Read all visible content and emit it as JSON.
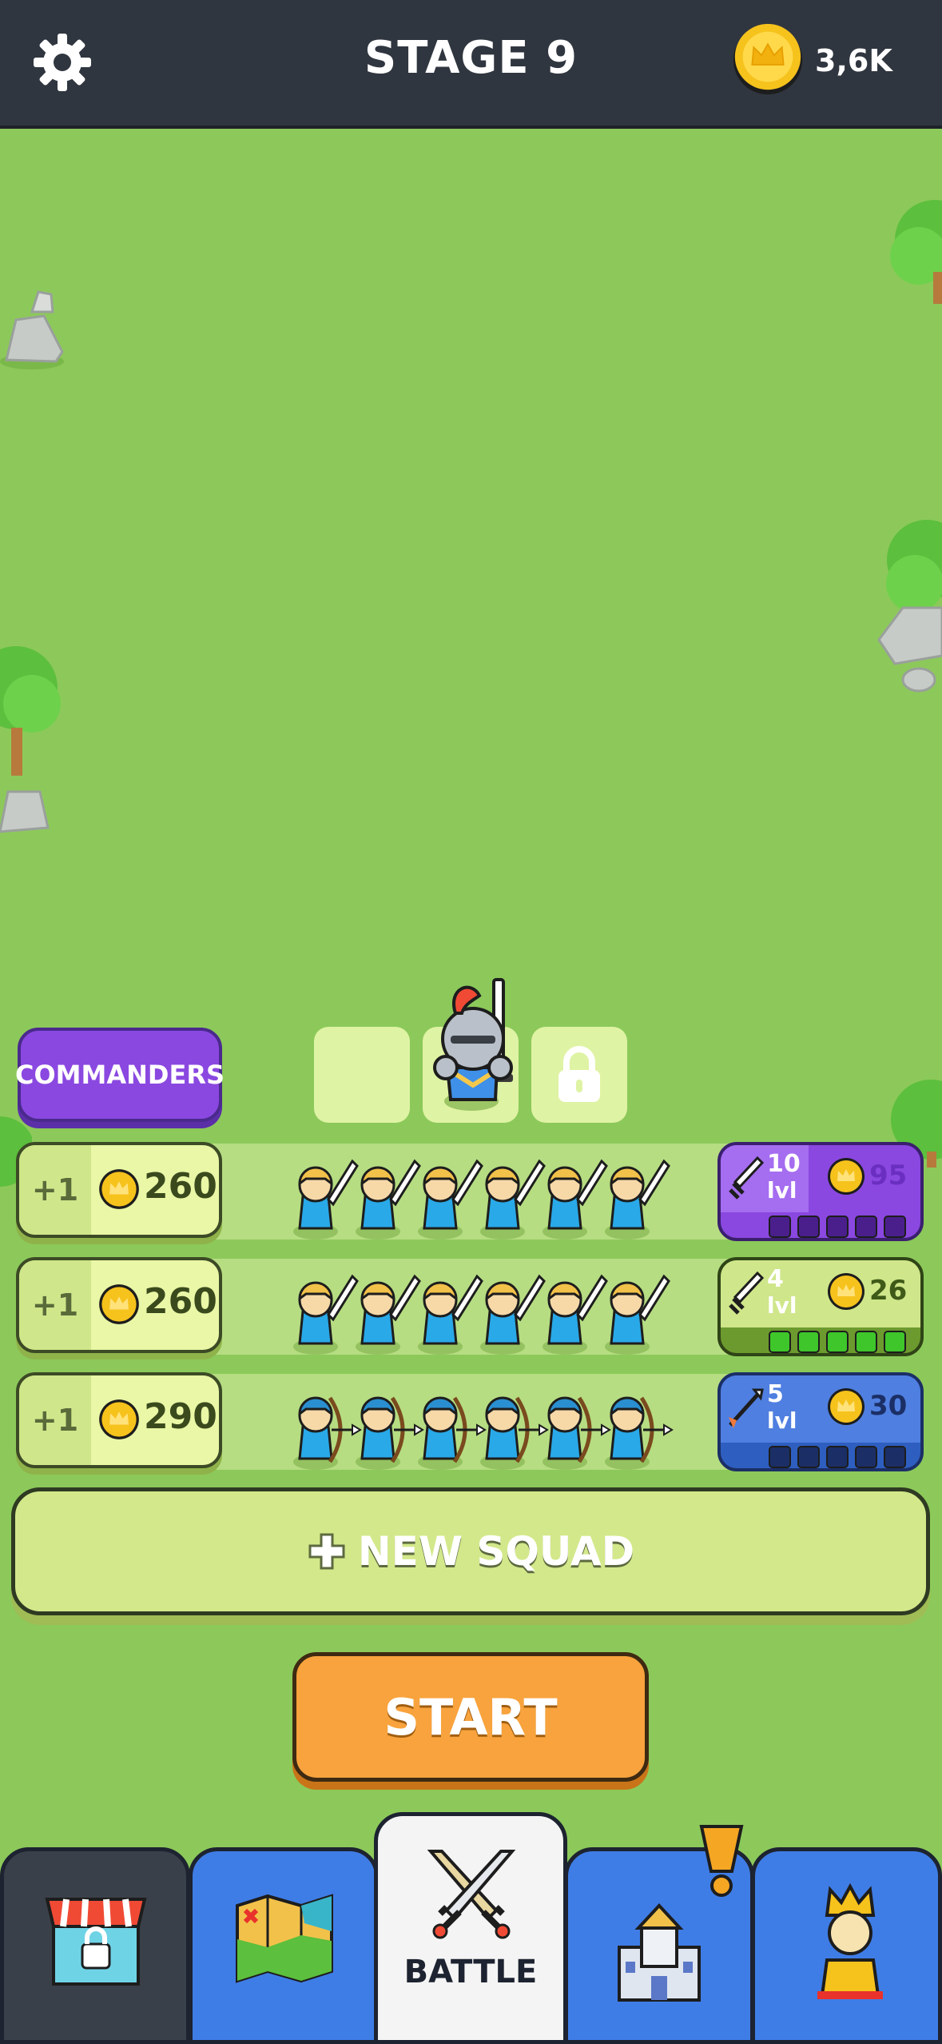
{
  "header": {
    "stage_title": "STAGE 9",
    "coins": "3,6K",
    "settings_icon": "gear-icon",
    "coin_icon": "crown-coin-icon"
  },
  "commanders": {
    "label": "COMMANDERS",
    "slots": [
      "empty",
      "knight-commander",
      "locked"
    ]
  },
  "squads": [
    {
      "buy_plus": "+1",
      "price": "260",
      "unit": "swordsman",
      "count": 6,
      "upgrade": {
        "level": "10",
        "lvl_label": "lvl",
        "cost": "95",
        "theme": "purple",
        "filled": 0,
        "total": 5
      }
    },
    {
      "buy_plus": "+1",
      "price": "260",
      "unit": "swordsman",
      "count": 6,
      "upgrade": {
        "level": "4",
        "lvl_label": "lvl",
        "cost": "26",
        "theme": "green",
        "filled": 5,
        "total": 5
      }
    },
    {
      "buy_plus": "+1",
      "price": "290",
      "unit": "archer",
      "count": 6,
      "upgrade": {
        "level": "5",
        "lvl_label": "lvl",
        "cost": "30",
        "theme": "blue",
        "filled": 0,
        "total": 5
      }
    }
  ],
  "new_squad": {
    "label": "NEW SQUAD"
  },
  "start": {
    "label": "START"
  },
  "nav": {
    "tabs": [
      {
        "name": "shop",
        "icon": "locked-shop-icon"
      },
      {
        "name": "map",
        "icon": "map-icon"
      },
      {
        "name": "battle",
        "icon": "crossed-swords-icon",
        "label": "BATTLE"
      },
      {
        "name": "castle",
        "icon": "castle-icon",
        "alert": "!"
      },
      {
        "name": "king",
        "icon": "king-icon"
      }
    ]
  },
  "colors": {
    "grass": "#8cc95a",
    "topbar": "#30363f",
    "commanders": "#8a48e0",
    "start": "#f8a33d",
    "nav_blue": "#3f7de6"
  }
}
